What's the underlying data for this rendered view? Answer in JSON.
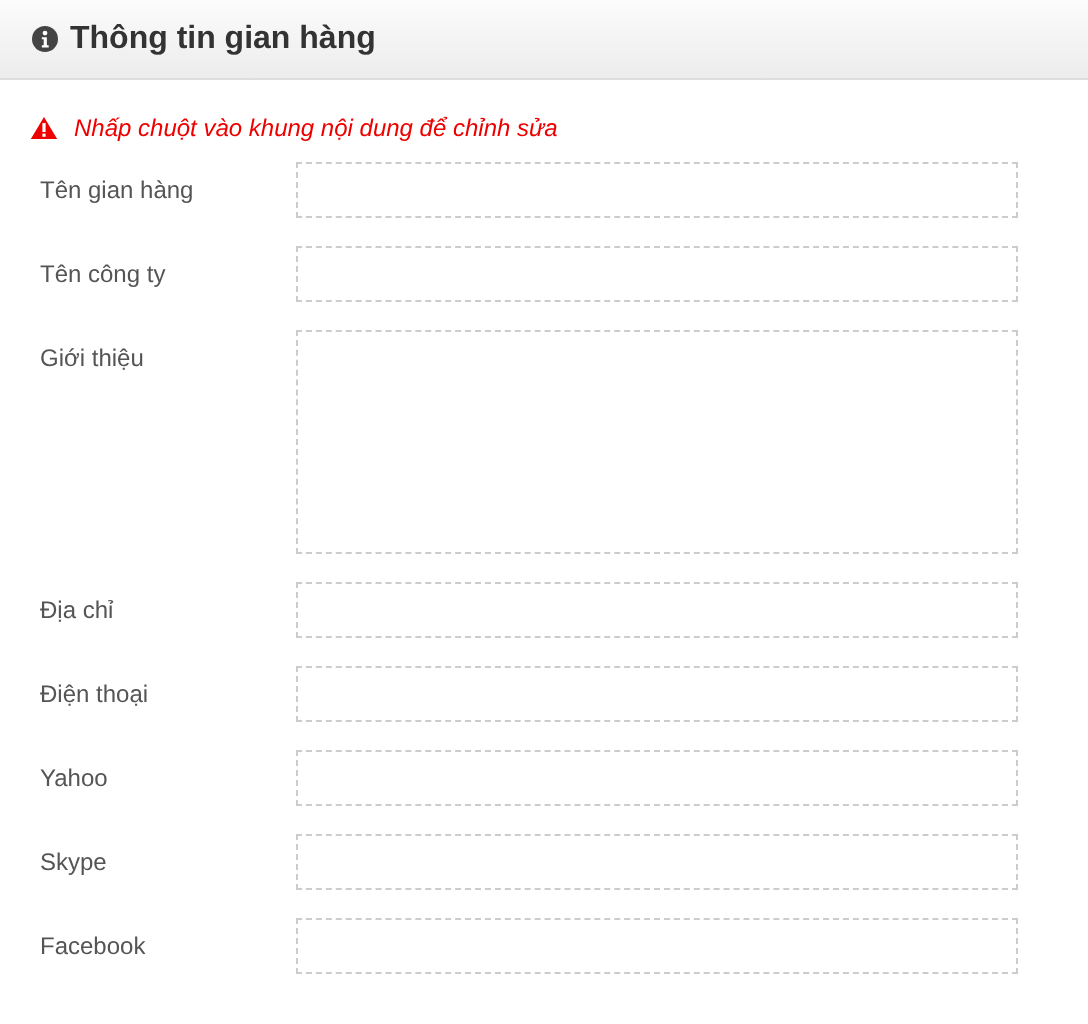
{
  "panel": {
    "title": "Thông tin gian hàng"
  },
  "notice": {
    "text": "Nhấp chuột vào khung nội dung để chỉnh sửa"
  },
  "fields": [
    {
      "label": "Tên gian hàng",
      "kind": "line"
    },
    {
      "label": "Tên công ty",
      "kind": "line"
    },
    {
      "label": "Giới thiệu",
      "kind": "area"
    },
    {
      "label": "Địa chỉ",
      "kind": "line"
    },
    {
      "label": "Điện thoại",
      "kind": "line"
    },
    {
      "label": "Yahoo",
      "kind": "line"
    },
    {
      "label": "Skype",
      "kind": "line"
    },
    {
      "label": "Facebook",
      "kind": "line"
    }
  ]
}
